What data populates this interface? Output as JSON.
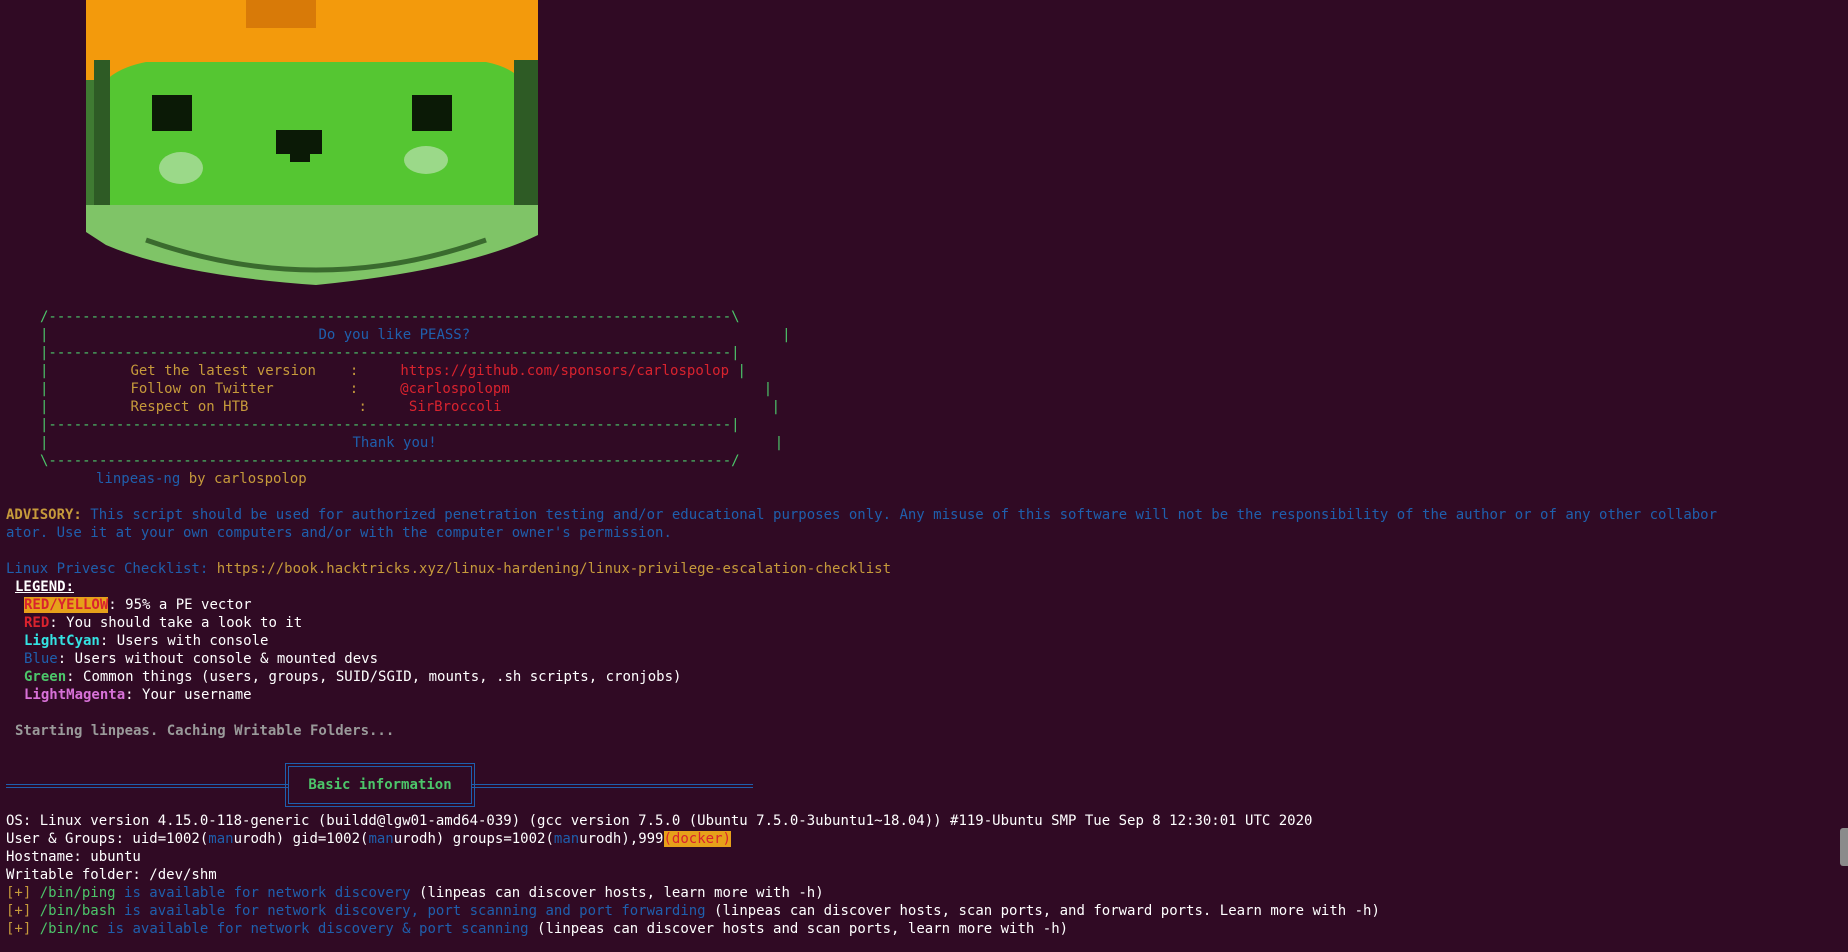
{
  "logo": {
    "name": "peass-logo"
  },
  "box": {
    "top": "/---------------------------------------------------------------------------------\\",
    "title": "Do you like PEASS?",
    "sep": "|---------------------------------------------------------------------------------|",
    "rows": [
      {
        "label": "Get the latest version",
        "sep": ":",
        "value": "https://github.com/sponsors/carlospolop"
      },
      {
        "label": "Follow on Twitter",
        "sep": ":",
        "value": "@carlospolopm"
      },
      {
        "label": "Respect on HTB",
        "sep": ":",
        "value": "SirBroccoli"
      }
    ],
    "thanks": "Thank you!",
    "bottom": "\\---------------------------------------------------------------------------------/"
  },
  "credit": {
    "name": "linpeas-ng",
    "by": "by carlospolop"
  },
  "advisory": {
    "label": "ADVISORY:",
    "line1": " This script should be used for authorized penetration testing and/or educational purposes only. Any misuse of this software will not be the responsibility of the author or of any other collabor",
    "line2": "ator. Use it at your own computers and/or with the computer owner's permission."
  },
  "checklist": {
    "label": "Linux Privesc Checklist:",
    "url": "https://book.hacktricks.xyz/linux-hardening/linux-privilege-escalation-checklist"
  },
  "legend": {
    "title": "LEGEND:",
    "items": [
      {
        "key": "RED/YELLOW",
        "desc": ": 95% a PE vector"
      },
      {
        "key": "RED",
        "desc": ": You should take a look to it"
      },
      {
        "key": "LightCyan",
        "desc": ": Users with console"
      },
      {
        "key": "Blue",
        "desc": ": Users without console & mounted devs"
      },
      {
        "key": "Green",
        "desc": ": Common things (users, groups, SUID/SGID, mounts, .sh scripts, cronjobs)"
      },
      {
        "key": "LightMagenta",
        "desc": ": Your username"
      }
    ]
  },
  "starting": "Starting linpeas. Caching Writable Folders...",
  "section": {
    "title": "Basic information"
  },
  "info": {
    "os": "OS: Linux version 4.15.0-118-generic (buildd@lgw01-amd64-039) (gcc version 7.5.0 (Ubuntu 7.5.0-3ubuntu1~18.04)) #119-Ubuntu SMP Tue Sep 8 12:30:01 UTC 2020",
    "ug_prefix": "User & Groups: uid=1002(",
    "ug_man1": "man",
    "ug_mid1": "urodh) gid=1002(",
    "ug_man2": "man",
    "ug_mid2": "urodh) groups=1002(",
    "ug_man3": "man",
    "ug_mid3": "urodh),999",
    "ug_docker": "(docker)",
    "hostname": "Hostname: ubuntu",
    "writable": "Writable folder: /dev/shm"
  },
  "tools": [
    {
      "bracket": "[+]",
      "path": "/bin/ping",
      "avail": " is available for network discovery",
      "note": " (linpeas can discover hosts, learn more with -h)"
    },
    {
      "bracket": "[+]",
      "path": "/bin/bash",
      "avail": " is available for network discovery, port scanning and port forwarding",
      "note": " (linpeas can discover hosts, scan ports, and forward ports. Learn more with -h)"
    },
    {
      "bracket": "[+]",
      "path": "/bin/nc",
      "avail": " is available for network discovery & port scanning",
      "note": " (linpeas can discover hosts and scan ports, learn more with -h)"
    }
  ],
  "colors": {
    "background": "#300a24",
    "green": "#4cc66a",
    "blue": "#1f5fad",
    "red": "#d9232e",
    "orange": "#e6a11a"
  }
}
